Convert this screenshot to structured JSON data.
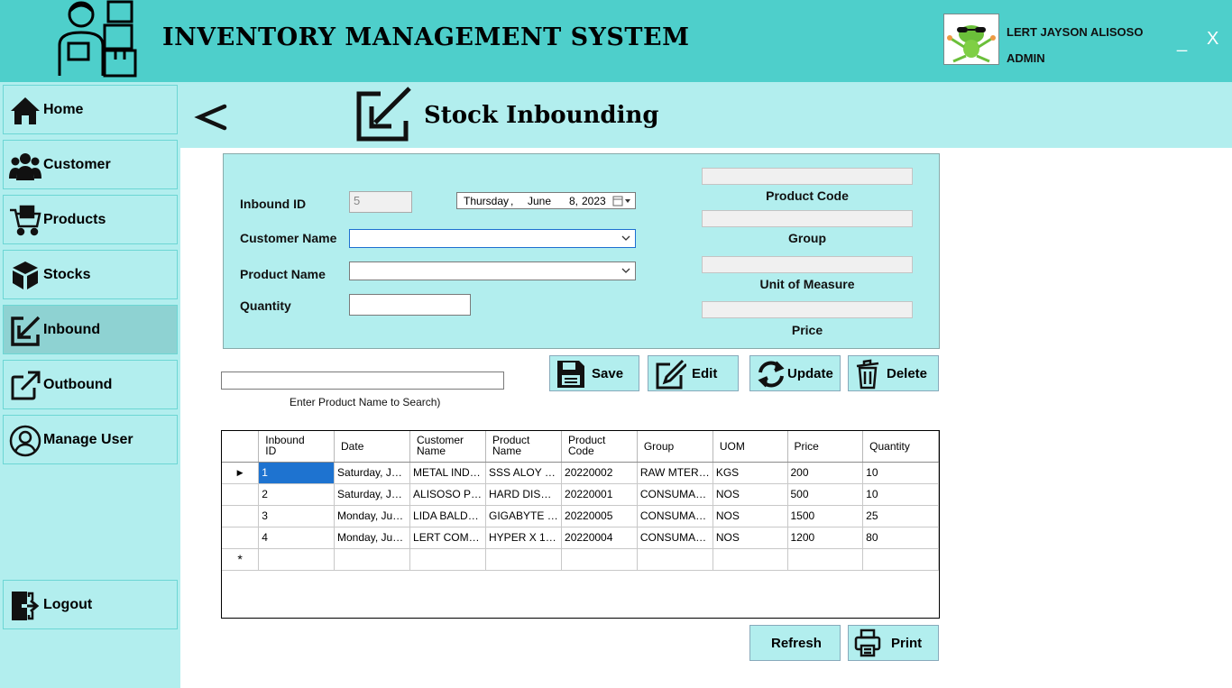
{
  "app": {
    "title": "INVENTORY MANAGEMENT SYSTEM"
  },
  "user": {
    "name": "LERT JAYSON ALISOSO",
    "role": "ADMIN"
  },
  "window": {
    "minimize": "_",
    "close": "X"
  },
  "sidebar": {
    "items": [
      {
        "label": "Home",
        "icon": "home-icon"
      },
      {
        "label": "Customer",
        "icon": "users-icon"
      },
      {
        "label": "Products",
        "icon": "cart-icon"
      },
      {
        "label": "Stocks",
        "icon": "boxes-icon"
      },
      {
        "label": "Inbound",
        "icon": "inbound-icon",
        "active": true
      },
      {
        "label": "Outbound",
        "icon": "outbound-icon"
      },
      {
        "label": "Manage User",
        "icon": "user-circle-icon"
      }
    ],
    "logout": "Logout"
  },
  "page": {
    "back": "<",
    "title": "Stock Inbounding"
  },
  "form": {
    "inbound_id_label": "Inbound ID",
    "inbound_id_value": "5",
    "date": {
      "weekday": "Thursday",
      "sep": ",",
      "month": "June",
      "day": "8,",
      "year": "2023"
    },
    "customer_label": "Customer Name",
    "product_label": "Product Name",
    "quantity_label": "Quantity",
    "product_code_label": "Product Code",
    "group_label": "Group",
    "uom_label": "Unit of Measure",
    "price_label": "Price"
  },
  "buttons": {
    "save": "Save",
    "edit": "Edit",
    "update": "Update",
    "delete": "Delete",
    "refresh": "Refresh",
    "print": "Print"
  },
  "search": {
    "hint": "Enter Product Name to Search)"
  },
  "grid": {
    "headers": [
      [
        "Inbound",
        "ID"
      ],
      [
        "Date",
        ""
      ],
      [
        "Customer",
        "Name"
      ],
      [
        "Product",
        "Name"
      ],
      [
        "Product",
        "Code"
      ],
      [
        "Group",
        ""
      ],
      [
        "UOM",
        ""
      ],
      [
        "Price",
        ""
      ],
      [
        "Quantity",
        ""
      ]
    ],
    "rows": [
      [
        "1",
        "Saturday, Jun...",
        "METAL INDU...",
        "SSS ALOY M...",
        "20220002",
        "RAW MTERIAL",
        "KGS",
        "200",
        "10"
      ],
      [
        "2",
        "Saturday, Jun...",
        "ALISOSO PR...",
        "HARD DISK ...",
        "20220001",
        "CONSUMABLE",
        "NOS",
        "500",
        "10"
      ],
      [
        "3",
        "Monday, June...",
        "LIDA BALDE...",
        "GIGABYTE M...",
        "20220005",
        "CONSUMABLE",
        "NOS",
        "1500",
        "25"
      ],
      [
        "4",
        "Monday, June...",
        "LERT COMP...",
        "HYPER X 16 ...",
        "20220004",
        "CONSUMABLE",
        "NOS",
        "1200",
        "80"
      ]
    ],
    "current_marker": "▶",
    "new_row_marker": "*"
  },
  "colors": {
    "header": "#4ecfcb",
    "sidebar": "#b2eeee",
    "selection": "#1e73d0"
  }
}
